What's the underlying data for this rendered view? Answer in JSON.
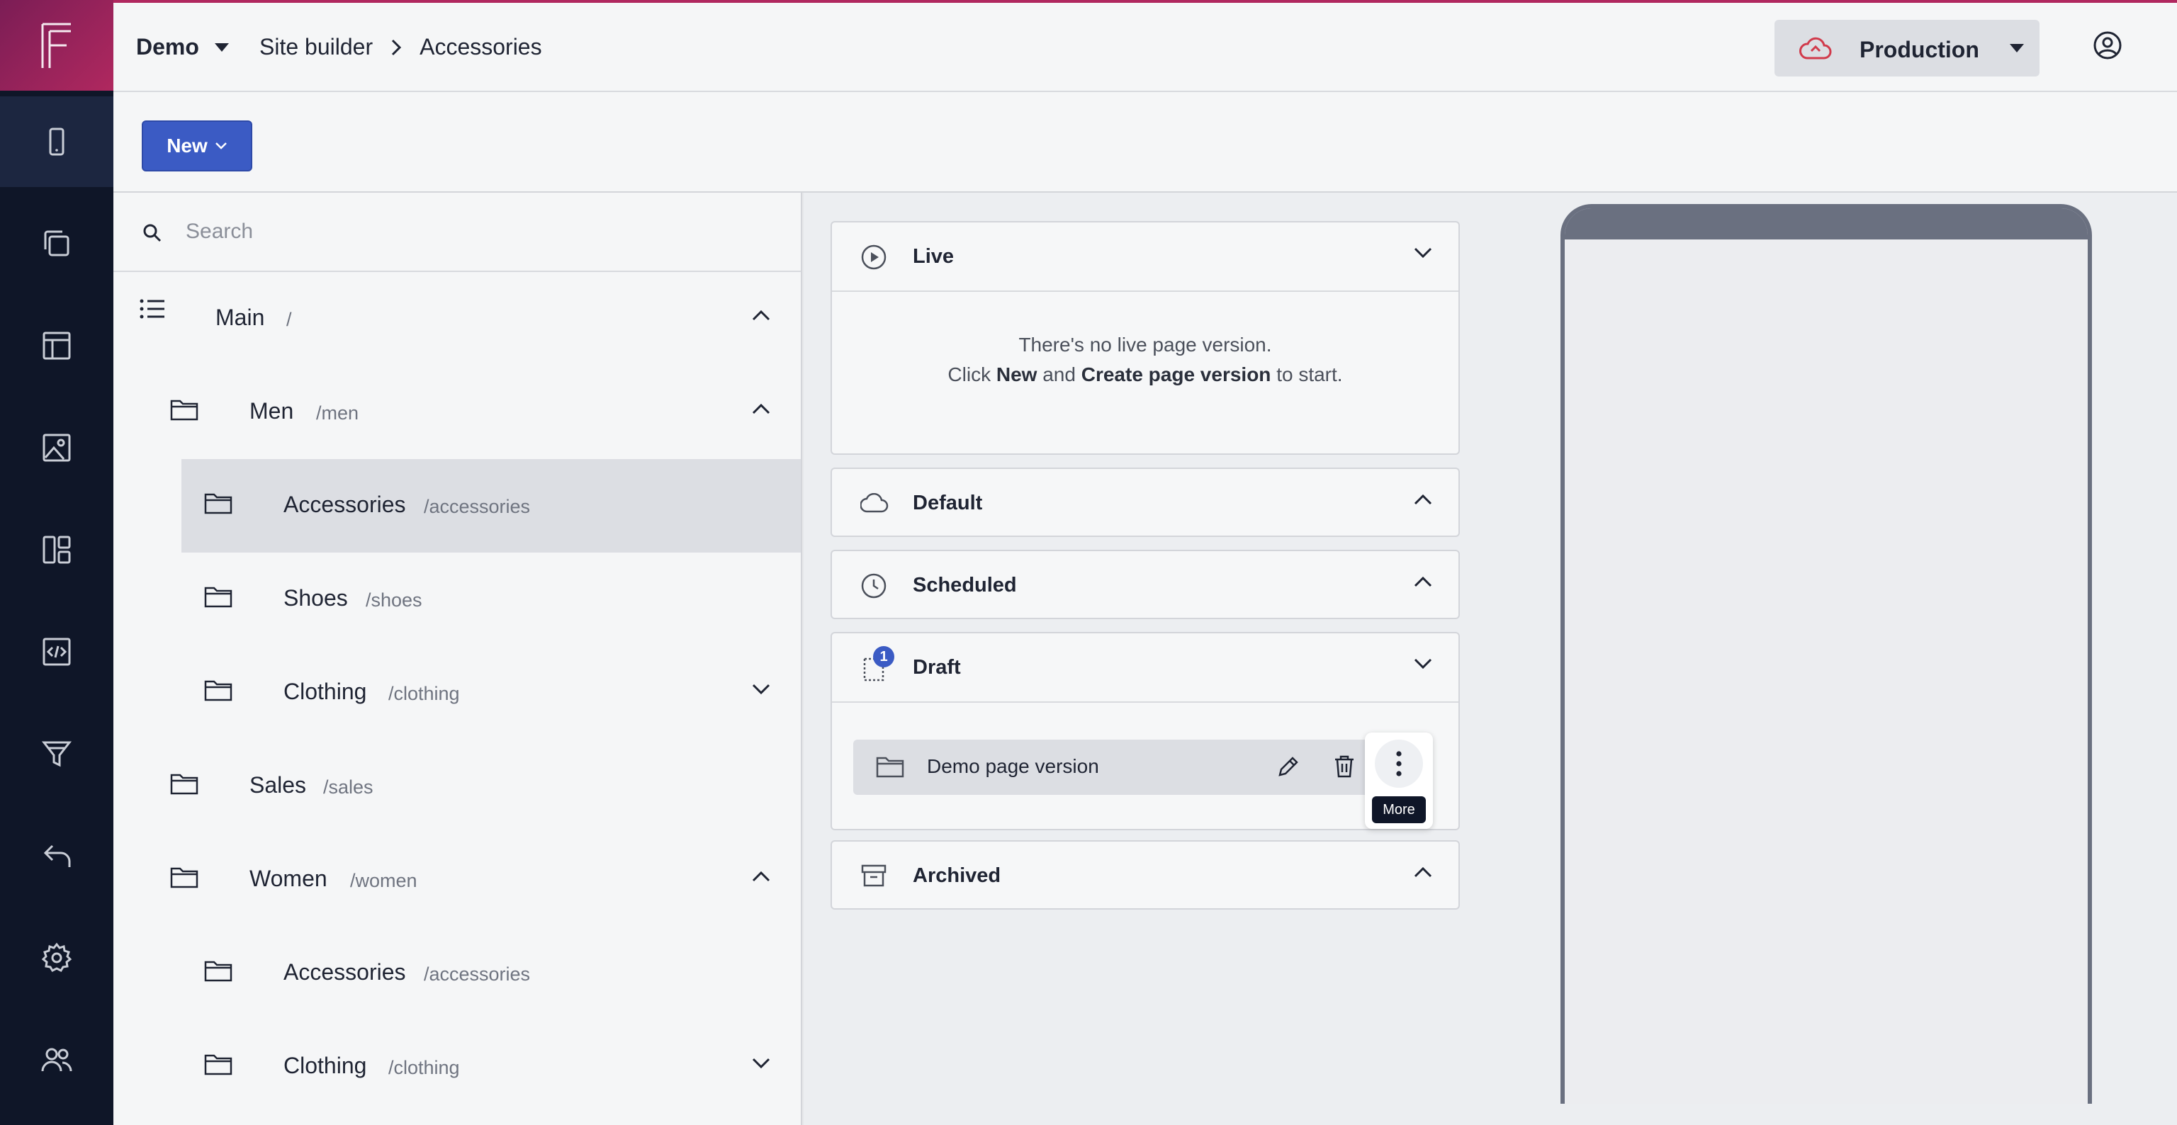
{
  "app": {
    "project": "Demo",
    "breadcrumbs": [
      "Site builder",
      "Accessories"
    ],
    "environment": "Production",
    "accent_color": "#b0285f",
    "primary_color": "#3b5bc4"
  },
  "rail": {
    "items": [
      {
        "icon": "mobile-icon"
      },
      {
        "icon": "pages-icon"
      },
      {
        "icon": "layout-icon"
      },
      {
        "icon": "image-icon"
      },
      {
        "icon": "dashboard-icon"
      },
      {
        "icon": "code-icon"
      },
      {
        "icon": "filter-icon"
      },
      {
        "icon": "undo-icon"
      },
      {
        "icon": "settings-icon"
      },
      {
        "icon": "users-icon"
      }
    ]
  },
  "toolbar": {
    "new_label": "New"
  },
  "tree": {
    "search_placeholder": "Search",
    "nodes": [
      {
        "name": "Main",
        "path": "/",
        "expanded": true
      },
      {
        "name": "Men",
        "path": "/men",
        "expanded": true
      },
      {
        "name": "Accessories",
        "path": "/accessories",
        "selected": true
      },
      {
        "name": "Shoes",
        "path": "/shoes"
      },
      {
        "name": "Clothing",
        "path": "/clothing",
        "expanded": false
      },
      {
        "name": "Sales",
        "path": "/sales"
      },
      {
        "name": "Women",
        "path": "/women",
        "expanded": true
      },
      {
        "name": "Accessories",
        "path": "/accessories"
      },
      {
        "name": "Clothing",
        "path": "/clothing",
        "expanded": false
      }
    ]
  },
  "versions": {
    "live": {
      "title": "Live",
      "empty_line1": "There's no live page version.",
      "empty_click": "Click",
      "empty_new": "New",
      "empty_and": "and",
      "empty_create": "Create page version",
      "empty_tail": "to start."
    },
    "default": {
      "title": "Default"
    },
    "scheduled": {
      "title": "Scheduled"
    },
    "draft": {
      "title": "Draft",
      "badge": "1",
      "items": [
        {
          "name": "Demo page version"
        }
      ]
    },
    "archived": {
      "title": "Archived"
    },
    "more_tooltip": "More"
  }
}
